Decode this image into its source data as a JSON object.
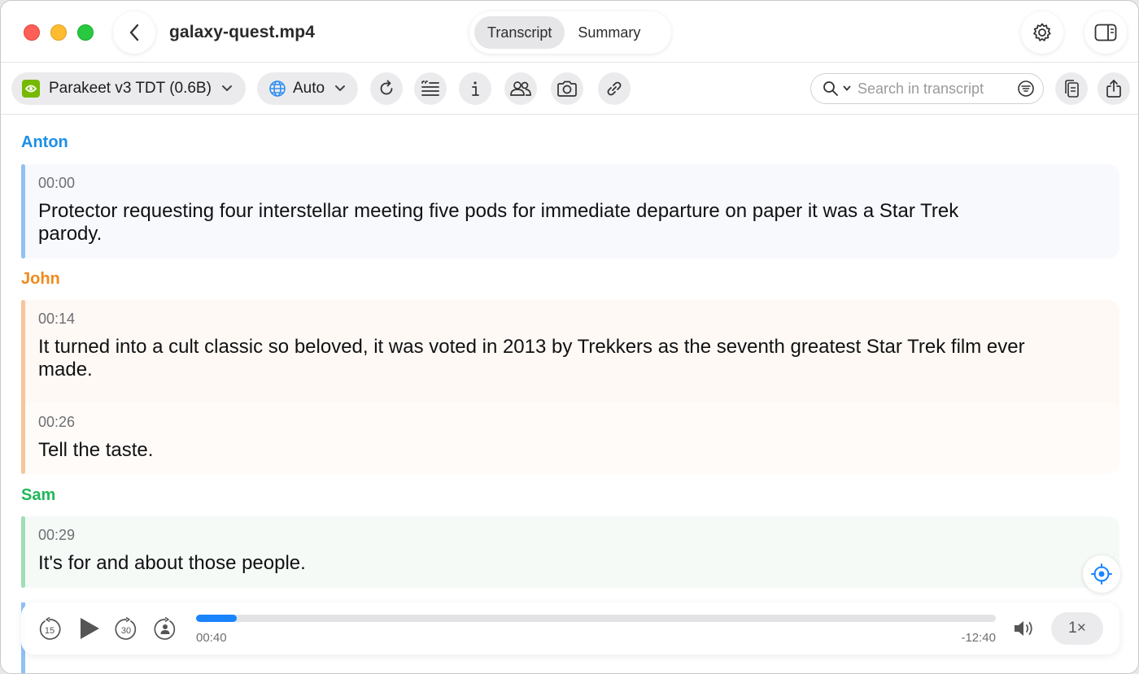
{
  "window": {
    "file_name": "galaxy-quest.mp4",
    "tabs": [
      {
        "label": "Transcript",
        "active": true
      },
      {
        "label": "Summary",
        "active": false
      }
    ]
  },
  "toolbar": {
    "model": "Parakeet v3 TDT (0.6B)",
    "language": "Auto",
    "tools": [
      "refresh-icon",
      "quote-lines-icon",
      "info-icon",
      "speakers-icon",
      "camera-icon",
      "link-icon"
    ],
    "search_placeholder": "Search in transcript"
  },
  "colors": {
    "anton": "#1b8fe6",
    "john": "#f08a1c",
    "sam": "#1fb85a",
    "accent": "#1a84ff"
  },
  "transcript": [
    {
      "speaker": "Anton",
      "segments": [
        {
          "time": "00:00",
          "text": "Protector requesting four interstellar meeting five pods for immediate departure on paper it was a Star Trek parody."
        }
      ]
    },
    {
      "speaker": "John",
      "segments": [
        {
          "time": "00:14",
          "text": "It turned into a cult classic so beloved, it was voted in 2013 by Trekkers as the seventh greatest Star Trek film ever made."
        },
        {
          "time": "00:26",
          "text": "Tell the taste."
        }
      ]
    },
    {
      "speaker": "Sam",
      "segments": [
        {
          "time": "00:29",
          "text": "It's for and about those people."
        }
      ]
    }
  ],
  "player": {
    "rewind_label": "15",
    "forward_label": "30",
    "elapsed": "00:40",
    "remaining": "-12:40",
    "progress_fraction": 0.051,
    "speed": "1×"
  }
}
